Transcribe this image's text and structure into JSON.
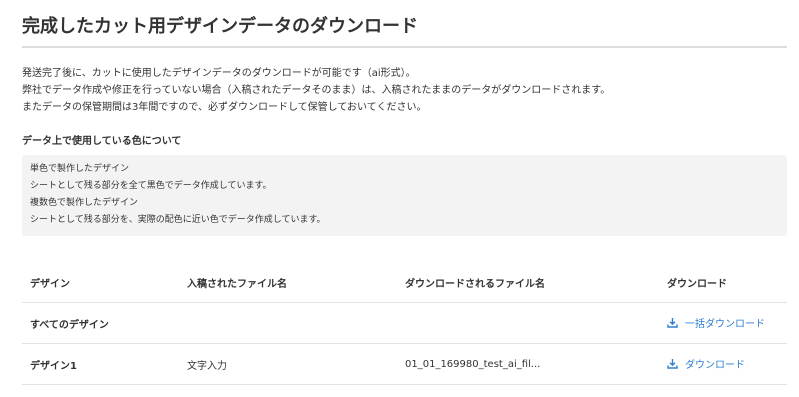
{
  "page": {
    "title": "完成したカット用デザインデータのダウンロード",
    "intro": [
      "発送完了後に、カットに使用したデザインデータのダウンロードが可能です（ai形式）。",
      "弊社でデータ作成や修正を行っていない場合（入稿されたデータそのまま）は、入稿されたままのデータがダウンロードされます。",
      "またデータの保管期間は3年間ですので、必ずダウンロードして保管しておいてください。"
    ]
  },
  "colors_section": {
    "heading": "データ上で使用している色について",
    "lines": [
      "単色で製作したデザイン",
      "シートとして残る部分を全て黒色でデータ作成しています。",
      "複数色で製作したデザイン",
      "シートとして残る部分を、実際の配色に近い色でデータ作成しています。"
    ]
  },
  "table": {
    "headers": [
      "デザイン",
      "入稿されたファイル名",
      "ダウンロードされるファイル名",
      "ダウンロード"
    ],
    "rows": [
      {
        "design": "すべてのデザイン",
        "uploaded": "",
        "download_name": "",
        "action_label": "一括ダウンロード",
        "action_icon": "download-icon"
      },
      {
        "design": "デザイン1",
        "uploaded": "文字入力",
        "download_name": "01_01_169980_test_ai_fil...",
        "action_label": "ダウンロード",
        "action_icon": "download-icon"
      }
    ]
  },
  "colors": {
    "link": "#2f7fd0",
    "text": "#333333",
    "box_bg": "#f3f3f3",
    "rule": "#dddddd"
  }
}
